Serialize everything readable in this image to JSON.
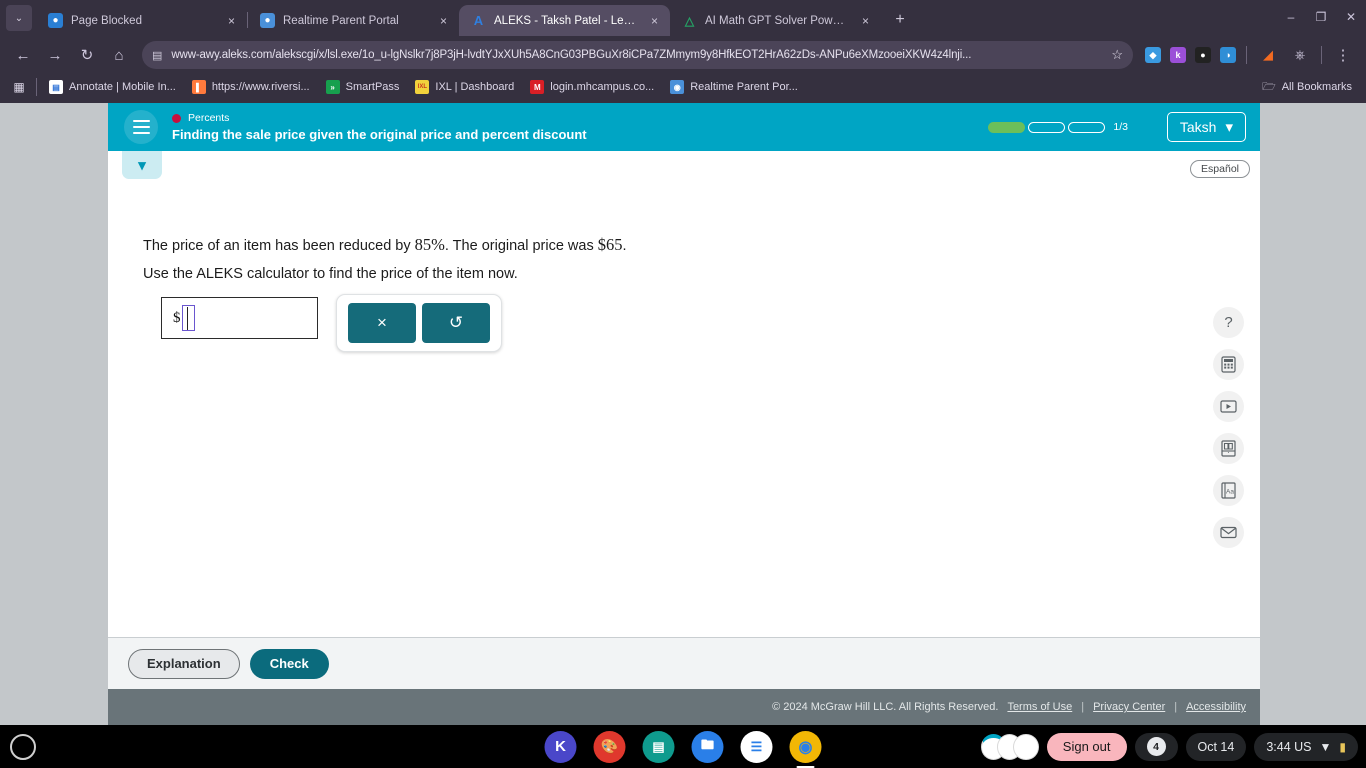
{
  "browser": {
    "tabs": [
      {
        "title": "Page Blocked",
        "icon": "chrome-globe-icon",
        "icon_color": "#2a7fd4",
        "icon_glyph": "◔",
        "active": false
      },
      {
        "title": "Realtime Parent Portal",
        "icon": "globe-icon",
        "icon_color": "#4a90d9",
        "icon_glyph": "⊕",
        "active": false
      },
      {
        "title": "ALEKS - Taksh Patel - Learn",
        "icon": "aleks-icon",
        "icon_color": "#1f6fd0",
        "icon_glyph": "A",
        "active": true
      },
      {
        "title": "AI Math GPT Solver Powered b",
        "icon": "ai-math-icon",
        "icon_color": "#1f9e5a",
        "icon_glyph": "Δ",
        "active": false
      }
    ],
    "new_tab_label": "+",
    "tab_close_label": "×",
    "tabs_dropdown_label": "⌄",
    "window_controls": {
      "minimize": "–",
      "maximize": "❐",
      "close": "✕"
    },
    "nav": {
      "back": "←",
      "forward": "→",
      "reload": "↻",
      "home": "⌂"
    },
    "address": {
      "url": "www-awy.aleks.com/alekscgi/x/lsl.exe/1o_u-lgNslkr7j8P3jH-lvdtYJxXUh5A8CnG03PBGuXr8iCPa7ZMmym9y8HfkEOT2HrA62zDs-ANPu6eXMzooeiXKW4z4lnji...",
      "site_icon": "page-info-icon",
      "bookmark_star": "☆"
    },
    "extensions": [
      {
        "name": "diamond-extension-icon",
        "glyph": "◆",
        "color": "#3a9ae0"
      },
      {
        "name": "kami-extension-icon",
        "glyph": "k",
        "color": "#9b4fd8"
      },
      {
        "name": "cat-extension-icon",
        "glyph": "●",
        "color": "#222222"
      },
      {
        "name": "moon-extension-icon",
        "glyph": "◕",
        "color": "#2f8ed6"
      }
    ],
    "profile_icon": "profile-avatar",
    "menu_icon": "⋮",
    "bookmarks": [
      {
        "label": "Annotate | Mobile In...",
        "glyph": "▤",
        "color": "#ffffff",
        "fg": "#2a6fd6"
      },
      {
        "label": "https://www.riversi...",
        "glyph": "‖",
        "color": "#ff7a3d",
        "fg": "#ffffff"
      },
      {
        "label": "SmartPass",
        "glyph": "»",
        "color": "#17a04e",
        "fg": "#ffffff"
      },
      {
        "label": "IXL | Dashboard",
        "glyph": "IXL",
        "color": "#f2d23c",
        "fg": "#c93a1e"
      },
      {
        "label": "login.mhcampus.co...",
        "glyph": "M",
        "color": "#d91f26",
        "fg": "#ffffff"
      },
      {
        "label": "Realtime Parent Por...",
        "glyph": "⊕",
        "color": "#4a90d9",
        "fg": "#ffffff"
      }
    ],
    "all_bookmarks_label": "All Bookmarks",
    "apps_grid_icon": "apps-grid-icon"
  },
  "aleks": {
    "header": {
      "menu_icon": "hamburger-menu-icon",
      "topic_label": "Percents",
      "topic_dot_color": "#c8103e",
      "title": "Finding the sale price given the original price and percent discount",
      "progress_segments": 3,
      "progress_filled": 1,
      "progress_label": "1/3",
      "progress_fill_color": "#6cbf5a",
      "user_name": "Taksh",
      "user_chevron": "⌄",
      "bg_color": "#00a5c4"
    },
    "problem": {
      "collapse_icon": "chevron-down-icon",
      "espanol_label": "Español",
      "line1_a": "The price of an item has been reduced by ",
      "line1_percent": "85%",
      "line1_b": ". The original price was ",
      "line1_price": "$65",
      "line1_c": ".",
      "line2": "Use the ALEKS calculator to find the price of the item now.",
      "answer_prefix": "$",
      "answer_value": "",
      "calc_clear_label": "×",
      "calc_undo_label": "↺"
    },
    "toolrail": [
      {
        "name": "help-icon",
        "glyph": "?"
      },
      {
        "name": "calculator-icon",
        "glyph": "▦"
      },
      {
        "name": "video-icon",
        "glyph": "▶"
      },
      {
        "name": "dictionary-icon",
        "glyph": "▤"
      },
      {
        "name": "glossary-icon",
        "glyph": "Aa"
      },
      {
        "name": "mail-icon",
        "glyph": "✉"
      }
    ],
    "actions": {
      "explanation_label": "Explanation",
      "check_label": "Check",
      "check_color": "#0b6b7d"
    },
    "footer": {
      "copyright": "© 2024 McGraw Hill LLC. All Rights Reserved.",
      "links": [
        "Terms of Use",
        "Privacy Center",
        "Accessibility"
      ],
      "separator": "|"
    }
  },
  "shelf": {
    "launcher_icon": "launcher-circle-icon",
    "apps": [
      {
        "name": "khan-academy-icon",
        "glyph": "K",
        "color": "#4a47c9",
        "active": false
      },
      {
        "name": "paint-icon",
        "glyph": "⚘",
        "color": "#e0382d",
        "active": false
      },
      {
        "name": "media-icon",
        "glyph": "▤",
        "color": "#0f9b8e",
        "active": false
      },
      {
        "name": "files-icon",
        "glyph": "▰",
        "color": "#2a7fe8",
        "active": false
      },
      {
        "name": "docs-icon",
        "glyph": "☰",
        "color": "#ffffff",
        "active": false
      },
      {
        "name": "chrome-icon",
        "glyph": "◉",
        "color": "#f2b705",
        "active": true
      }
    ],
    "sign_out_label": "Sign out",
    "notification_count": "4",
    "date": "Oct 14",
    "time": "3:44 US",
    "wifi_icon": "wifi-icon",
    "battery_icon": "battery-icon"
  }
}
